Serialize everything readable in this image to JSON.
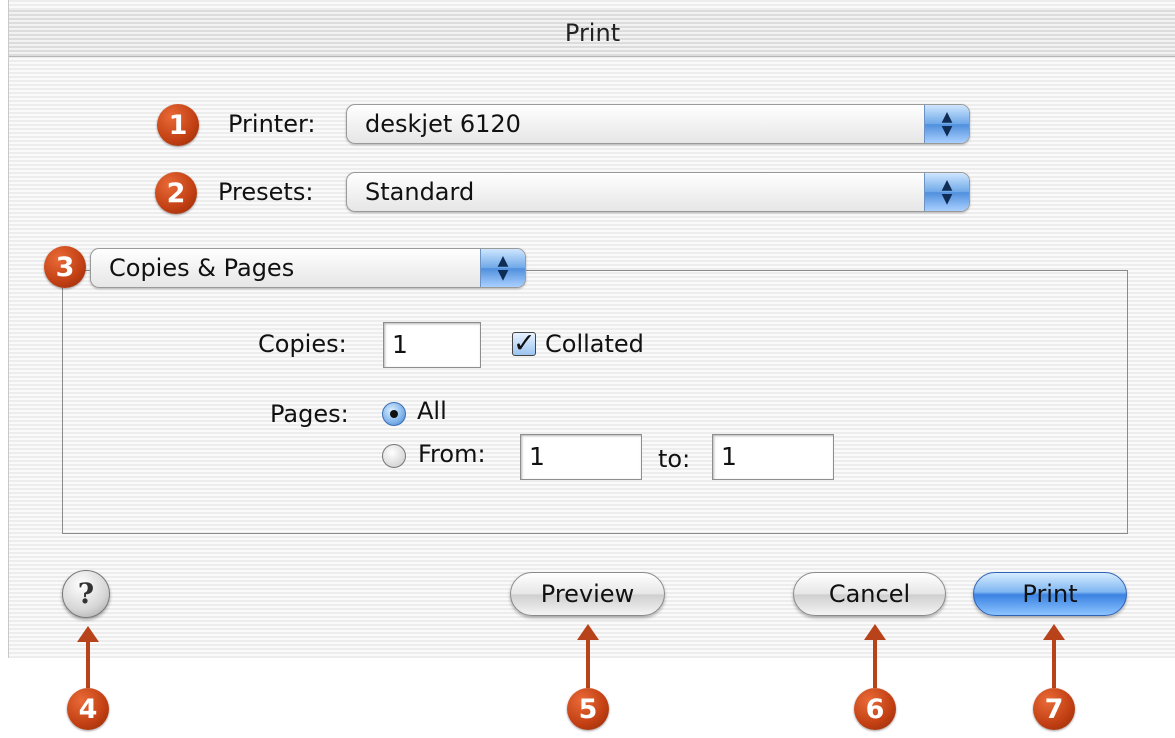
{
  "window": {
    "title": "Print"
  },
  "printer": {
    "label": "Printer:",
    "value": "deskjet 6120"
  },
  "presets": {
    "label": "Presets:",
    "value": "Standard"
  },
  "panel": {
    "value": "Copies & Pages"
  },
  "copies": {
    "label": "Copies:",
    "value": "1",
    "collated_label": "Collated",
    "collated_checked": true
  },
  "pages": {
    "label": "Pages:",
    "all_label": "All",
    "from_label": "From:",
    "from_value": "1",
    "to_label": "to:",
    "to_value": "1",
    "selected": "All"
  },
  "buttons": {
    "help": "?",
    "preview": "Preview",
    "cancel": "Cancel",
    "print": "Print"
  },
  "callouts": [
    "1",
    "2",
    "3",
    "4",
    "5",
    "6",
    "7"
  ],
  "colors": {
    "callout": "#c1461a",
    "default_button": "#3a82e2"
  }
}
